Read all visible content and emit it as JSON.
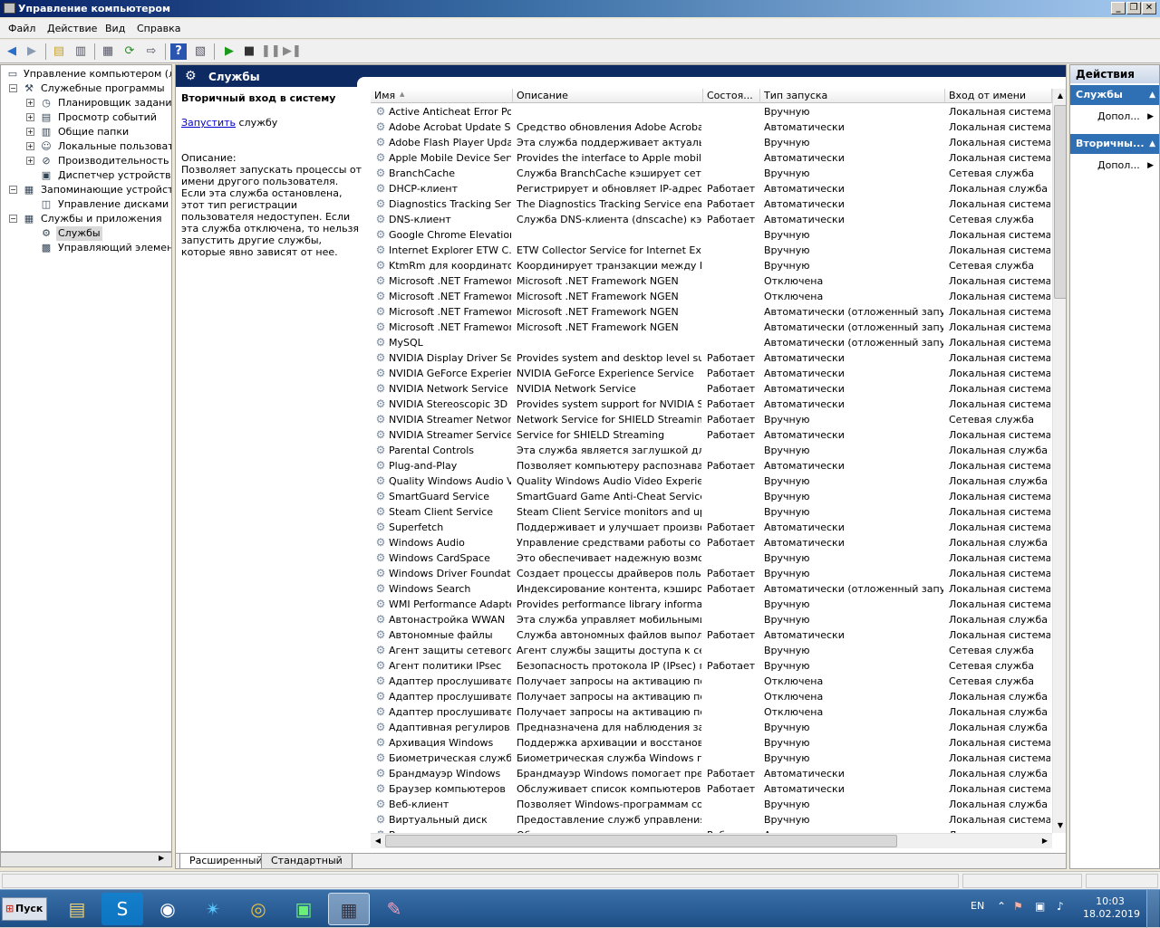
{
  "window": {
    "title": "Управление компьютером"
  },
  "menu": [
    "Файл",
    "Действие",
    "Вид",
    "Справка"
  ],
  "tree": [
    {
      "label": "Управление компьютером (локал",
      "indent": 0,
      "icon": "computer-icon",
      "expander": ""
    },
    {
      "label": "Служебные программы",
      "indent": 1,
      "icon": "tools-icon",
      "expander": "−"
    },
    {
      "label": "Планировщик заданий",
      "indent": 2,
      "icon": "clock-icon",
      "expander": "+"
    },
    {
      "label": "Просмотр событий",
      "indent": 2,
      "icon": "event-viewer-icon",
      "expander": "+"
    },
    {
      "label": "Общие папки",
      "indent": 2,
      "icon": "shared-folder-icon",
      "expander": "+"
    },
    {
      "label": "Локальные пользовател",
      "indent": 2,
      "icon": "users-icon",
      "expander": "+"
    },
    {
      "label": "Производительность",
      "indent": 2,
      "icon": "performance-icon",
      "expander": "+"
    },
    {
      "label": "Диспетчер устройств",
      "indent": 2,
      "icon": "device-manager-icon",
      "expander": ""
    },
    {
      "label": "Запоминающие устройства",
      "indent": 1,
      "icon": "storage-icon",
      "expander": "−"
    },
    {
      "label": "Управление дисками",
      "indent": 2,
      "icon": "disk-icon",
      "expander": ""
    },
    {
      "label": "Службы и приложения",
      "indent": 1,
      "icon": "services-apps-icon",
      "expander": "−"
    },
    {
      "label": "Службы",
      "indent": 2,
      "icon": "gear-icon",
      "expander": "",
      "selected": true
    },
    {
      "label": "Управляющий элемент W",
      "indent": 2,
      "icon": "wmi-icon",
      "expander": ""
    }
  ],
  "pane": {
    "title": "Службы"
  },
  "detail": {
    "title": "Вторичный вход в систему",
    "link": "Запустить",
    "link_suffix": " службу",
    "desc_label": "Описание:",
    "desc_text": "Позволяет запускать процессы от имени другого пользователя. Если эта служба остановлена, этот тип регистрации пользователя недоступен. Если эта служба отключена, то нельзя запустить другие службы, которые явно зависят от нее."
  },
  "columns": [
    "Имя",
    "Описание",
    "Состоя...",
    "Тип запуска",
    "Вход от имени"
  ],
  "rows": [
    [
      "Active Anticheat Error Po...",
      "",
      "",
      "Вручную",
      "Локальная система"
    ],
    [
      "Adobe Acrobat Update S...",
      "Средство обновления Adobe Acroba...",
      "",
      "Автоматически",
      "Локальная система"
    ],
    [
      "Adobe Flash Player Upda...",
      "Эта служба поддерживает актуаль...",
      "",
      "Вручную",
      "Локальная система"
    ],
    [
      "Apple Mobile Device Service",
      "Provides the interface to Apple mobile ...",
      "",
      "Автоматически",
      "Локальная система"
    ],
    [
      "BranchCache",
      "Служба BranchCache кэширует сетевое соде...",
      "",
      "Вручную",
      "Сетевая служба"
    ],
    [
      "DHCP-клиент",
      "Регистрирует и обновляет IP-адрес...",
      "Работает",
      "Автоматически",
      "Локальная служба"
    ],
    [
      "Diagnostics Tracking Service",
      "The Diagnostics Tracking Service enabl...",
      "Работает",
      "Автоматически",
      "Локальная система"
    ],
    [
      "DNS-клиент",
      "Служба DNS-клиента (dnscache) кэш...",
      "Работает",
      "Автоматически",
      "Сетевая служба"
    ],
    [
      "Google Chrome Elevation ...",
      "",
      "",
      "Вручную",
      "Локальная система"
    ],
    [
      "Internet Explorer ETW C...",
      "ETW Collector Service for Internet Exp...",
      "",
      "Вручную",
      "Локальная система"
    ],
    [
      "KtmRm для координато...",
      "Координирует транзакции между М...",
      "",
      "Вручную",
      "Сетевая служба"
    ],
    [
      "Microsoft .NET Framewor...",
      "Microsoft .NET Framework NGEN",
      "",
      "Отключена",
      "Локальная система"
    ],
    [
      "Microsoft .NET Framewor...",
      "Microsoft .NET Framework NGEN",
      "",
      "Отключена",
      "Локальная система"
    ],
    [
      "Microsoft .NET Framewor...",
      "Microsoft .NET Framework NGEN",
      "",
      "Автоматически (отложенный запуск)",
      "Локальная система"
    ],
    [
      "Microsoft .NET Framewor...",
      "Microsoft .NET Framework NGEN",
      "",
      "Автоматически (отложенный запуск)",
      "Локальная система"
    ],
    [
      "MySQL",
      "",
      "",
      "Автоматически (отложенный запуск)",
      "Локальная система"
    ],
    [
      "NVIDIA Display Driver Ser...",
      "Provides system and desktop level sup...",
      "Работает",
      "Автоматически",
      "Локальная система"
    ],
    [
      "NVIDIA GeForce Experien...",
      "NVIDIA GeForce Experience Service",
      "Работает",
      "Автоматически",
      "Локальная система"
    ],
    [
      "NVIDIA Network Service",
      "NVIDIA Network Service",
      "Работает",
      "Автоматически",
      "Локальная система"
    ],
    [
      "NVIDIA Stereoscopic 3D ...",
      "Provides system support for NVIDIA St...",
      "Работает",
      "Автоматически",
      "Локальная система"
    ],
    [
      "NVIDIA Streamer Networ...",
      "Network Service for SHIELD Streaming",
      "Работает",
      "Вручную",
      "Сетевая служба"
    ],
    [
      "NVIDIA Streamer Service",
      "Service for SHIELD Streaming",
      "Работает",
      "Автоматически",
      "Локальная система"
    ],
    [
      "Parental Controls",
      "Эта служба является заглушкой дл...",
      "",
      "Вручную",
      "Локальная служба"
    ],
    [
      "Plug-and-Play",
      "Позволяет компьютеру распознава...",
      "Работает",
      "Автоматически",
      "Локальная система"
    ],
    [
      "Quality Windows Audio Vi...",
      "Quality Windows Audio Video Experien...",
      "",
      "Вручную",
      "Локальная служба"
    ],
    [
      "SmartGuard Service",
      "SmartGuard Game Anti-Cheat Service",
      "",
      "Вручную",
      "Локальная система"
    ],
    [
      "Steam Client Service",
      "Steam Client Service monitors and upd...",
      "",
      "Вручную",
      "Локальная система"
    ],
    [
      "Superfetch",
      "Поддерживает и улучшает произво...",
      "Работает",
      "Автоматически",
      "Локальная система"
    ],
    [
      "Windows Audio",
      "Управление средствами работы со з...",
      "Работает",
      "Автоматически",
      "Локальная служба"
    ],
    [
      "Windows CardSpace",
      "Это обеспечивает надежную возмо...",
      "",
      "Вручную",
      "Локальная система"
    ],
    [
      "Windows Driver Foundati...",
      "Создает процессы драйверов польз...",
      "Работает",
      "Вручную",
      "Локальная система"
    ],
    [
      "Windows Search",
      "Индексирование контента, кэширов...",
      "Работает",
      "Автоматически (отложенный запуск)",
      "Локальная система"
    ],
    [
      "WMI Performance Adapter",
      "Provides performance library informati...",
      "",
      "Вручную",
      "Локальная система"
    ],
    [
      "Автонастройка WWAN",
      "Эта служба управляет мобильными ...",
      "",
      "Вручную",
      "Локальная служба"
    ],
    [
      "Автономные файлы",
      "Служба автономных файлов выполн...",
      "Работает",
      "Автоматически",
      "Локальная система"
    ],
    [
      "Агент защиты сетевого ...",
      "Агент службы защиты доступа к се...",
      "",
      "Вручную",
      "Сетевая служба"
    ],
    [
      "Агент политики IPsec",
      "Безопасность протокола IP (IPsec) п...",
      "Работает",
      "Вручную",
      "Сетевая служба"
    ],
    [
      "Адаптер прослушивате...",
      "Получает запросы на активацию по...",
      "",
      "Отключена",
      "Сетевая служба"
    ],
    [
      "Адаптер прослушивате...",
      "Получает запросы на активацию по...",
      "",
      "Отключена",
      "Локальная служба"
    ],
    [
      "Адаптер прослушивате...",
      "Получает запросы на активацию по...",
      "",
      "Отключена",
      "Локальная служба"
    ],
    [
      "Адаптивная регулиров...",
      "Предназначена для наблюдения за ...",
      "",
      "Вручную",
      "Локальная служба"
    ],
    [
      "Архивация Windows",
      "Поддержка архивации и восстановл...",
      "",
      "Вручную",
      "Локальная система"
    ],
    [
      "Биометрическая служба...",
      "Биометрическая служба Windows пр...",
      "",
      "Вручную",
      "Локальная система"
    ],
    [
      "Брандмауэр Windows",
      "Брандмауэр Windows помогает пред...",
      "Работает",
      "Автоматически",
      "Локальная служба"
    ],
    [
      "Браузер компьютеров",
      "Обслуживает список компьютеров ...",
      "Работает",
      "Автоматически",
      "Локальная система"
    ],
    [
      "Веб-клиент",
      "Позволяет Windows-программам соз...",
      "",
      "Вручную",
      "Локальная служба"
    ],
    [
      "Виртуальный диск",
      "Предоставление служб управления ...",
      "",
      "Вручную",
      "Локальная система"
    ],
    [
      "Вспомогательная служб...",
      "Обеспечивает возможность туннел...",
      "Работает",
      "Автоматически",
      "Локальная система"
    ]
  ],
  "tabs": [
    "Расширенный",
    "Стандартный"
  ],
  "actions": {
    "header": "Действия",
    "sections": [
      {
        "title": "Службы",
        "item": "Допол..."
      },
      {
        "title": "Вторичны...",
        "item": "Допол..."
      }
    ]
  },
  "taskbar": {
    "start": "Пуск",
    "apps": [
      "explorer-icon",
      "skype-icon",
      "steam-icon",
      "battlenet-icon",
      "chrome-icon",
      "performance-monitor-icon",
      "computer-management-icon",
      "paint-icon"
    ],
    "lang": "EN",
    "time": "10:03",
    "date": "18.02.2019"
  }
}
